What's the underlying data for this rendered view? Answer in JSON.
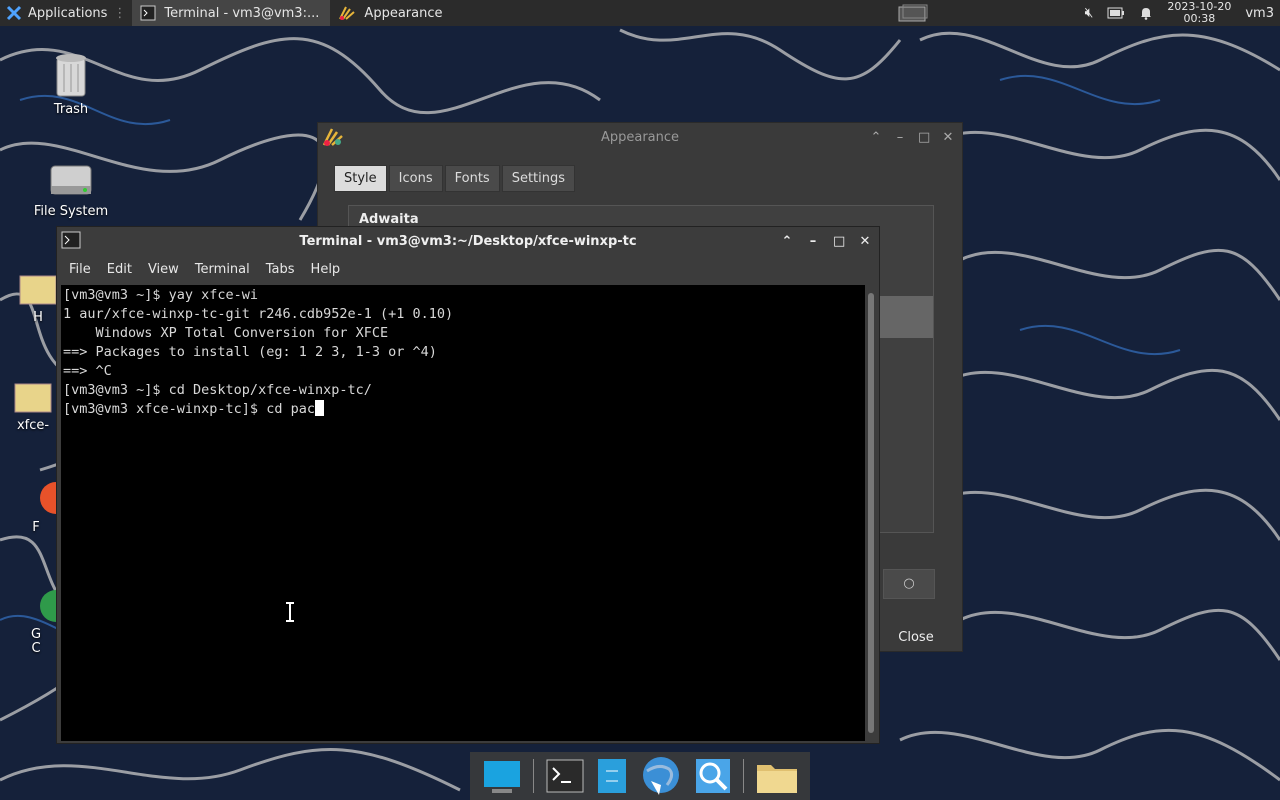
{
  "panel": {
    "applications_label": "Applications",
    "tasks": [
      {
        "label": "Terminal - vm3@vm3:...",
        "icon": "terminal-icon",
        "active": true
      },
      {
        "label": "Appearance",
        "icon": "appearance-icon",
        "active": false
      }
    ],
    "clock_date": "2023-10-20",
    "clock_time": "00:38",
    "user": "vm3"
  },
  "desktop": {
    "icons": [
      {
        "label": "Trash",
        "icon": "trash-icon"
      },
      {
        "label": "File System",
        "icon": "drive-icon"
      },
      {
        "label": "H",
        "icon": "folder-icon"
      },
      {
        "label": "xfce-",
        "icon": "folder-icon"
      },
      {
        "label": "F",
        "icon": "firefox-icon"
      },
      {
        "label": "G\nC",
        "icon": "chrome-icon"
      }
    ]
  },
  "appearance": {
    "title": "Appearance",
    "tabs": [
      "Style",
      "Icons",
      "Fonts",
      "Settings"
    ],
    "selected_tab": "Style",
    "theme_first": "Adwaita",
    "close_label": "Close"
  },
  "terminal": {
    "title": "Terminal - vm3@vm3:~/Desktop/xfce-winxp-tc",
    "menu": [
      "File",
      "Edit",
      "View",
      "Terminal",
      "Tabs",
      "Help"
    ],
    "lines": [
      "[vm3@vm3 ~]$ yay xfce-wi",
      "1 aur/xfce-winxp-tc-git r246.cdb952e-1 (+1 0.10)",
      "    Windows XP Total Conversion for XFCE",
      "==> Packages to install (eg: 1 2 3, 1-3 or ^4)",
      "==> ^C",
      "[vm3@vm3 ~]$ cd Desktop/xfce-winxp-tc/"
    ],
    "current_line": "[vm3@vm3 xfce-winxp-tc]$ cd pac"
  },
  "dock": {
    "items": [
      "desktop-icon",
      "terminal-icon",
      "file-manager-icon",
      "browser-icon",
      "search-icon",
      "folder-icon"
    ]
  }
}
